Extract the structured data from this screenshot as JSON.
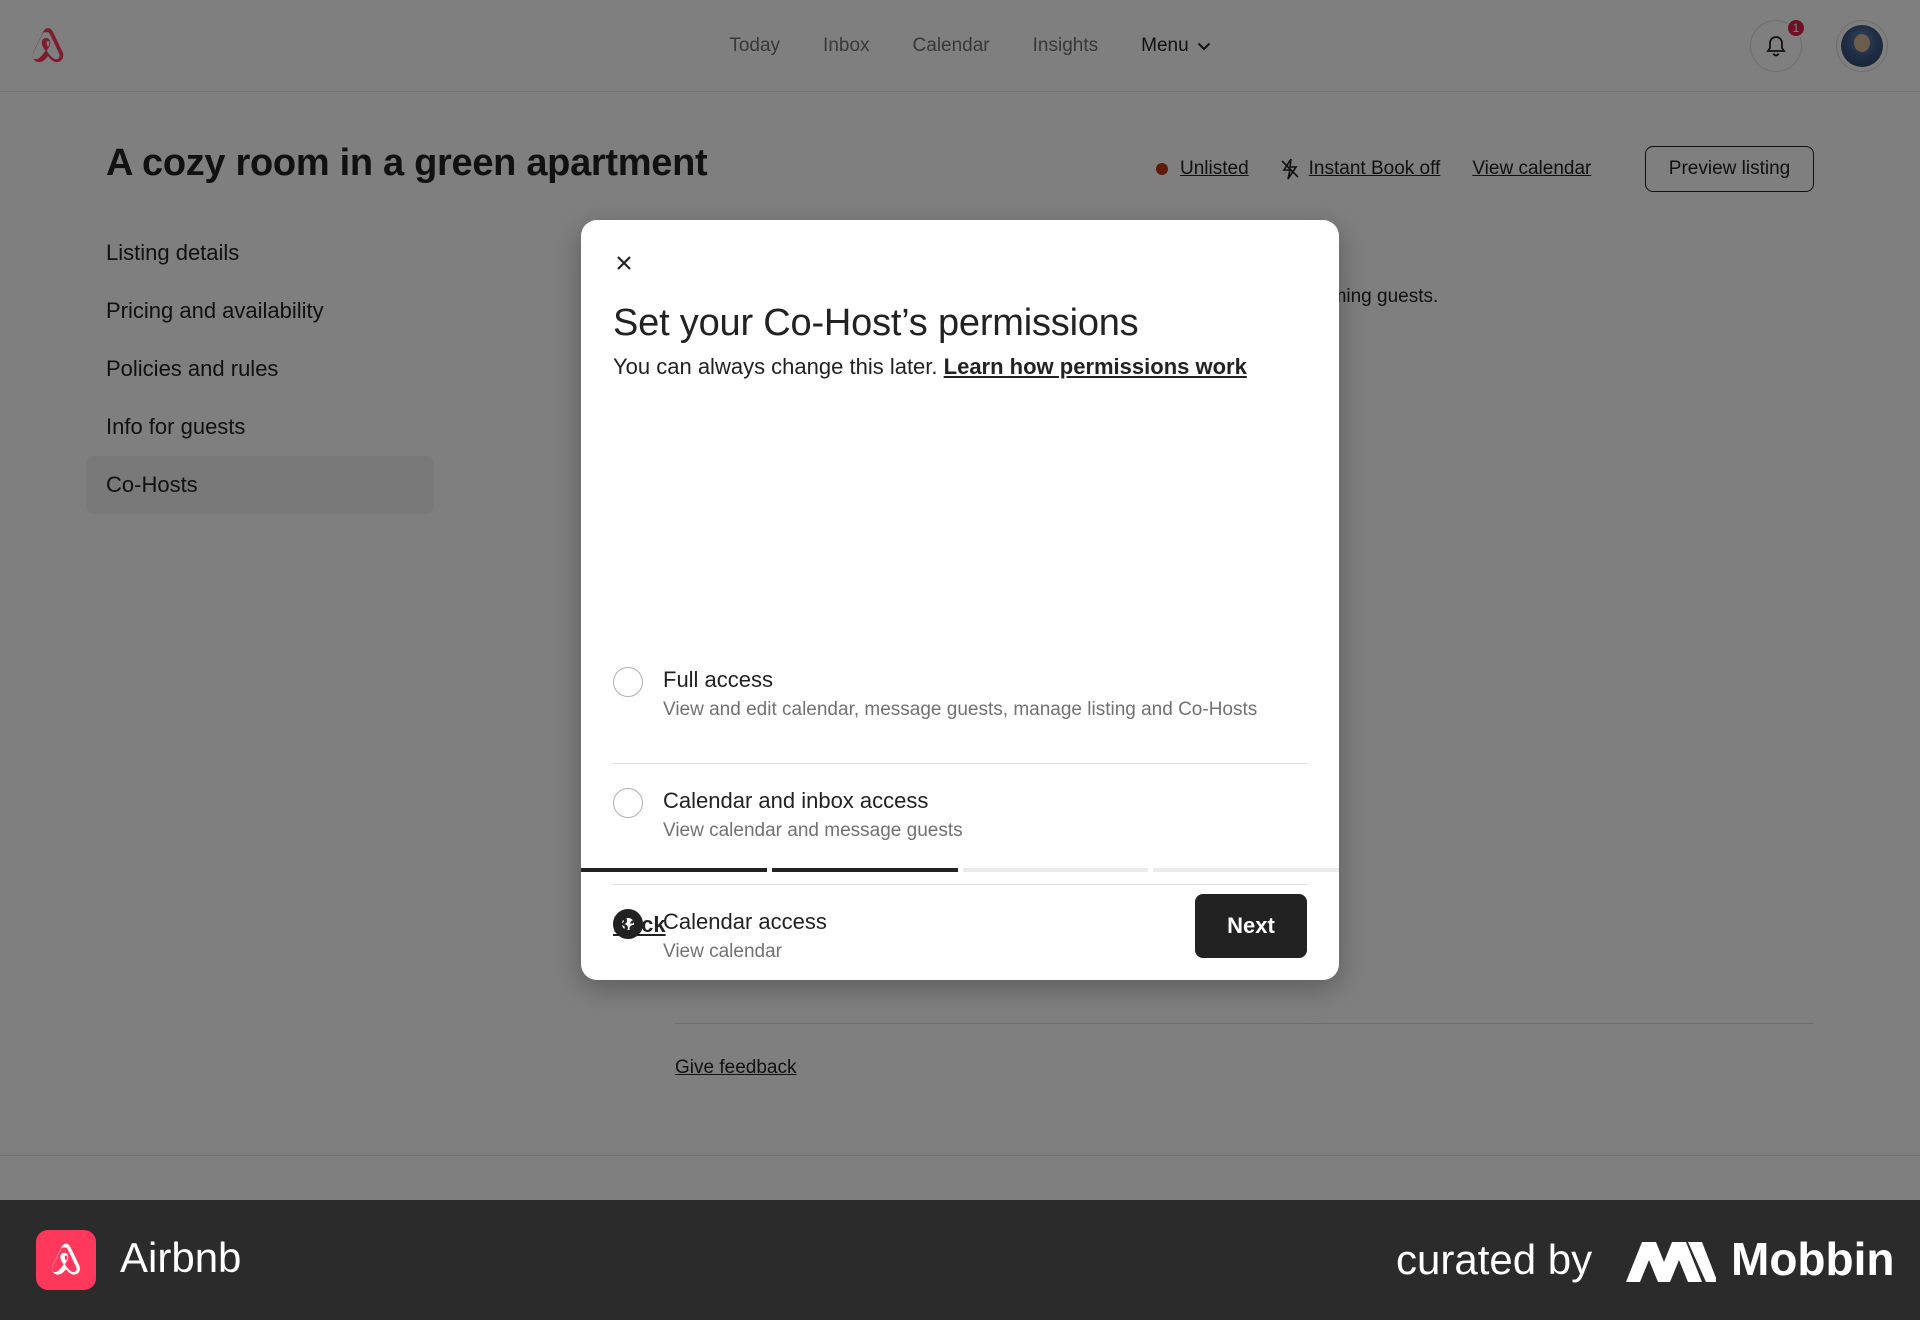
{
  "nav": {
    "links": [
      "Today",
      "Inbox",
      "Calendar",
      "Insights"
    ],
    "menu_label": "Menu",
    "notification_count": "1"
  },
  "listing": {
    "title": "A cozy room in a green apartment",
    "status": "Unlisted",
    "instant_book": "Instant Book off",
    "view_calendar": "View calendar",
    "preview": "Preview listing"
  },
  "sidebar": {
    "items": [
      {
        "label": "Listing details"
      },
      {
        "label": "Pricing and availability"
      },
      {
        "label": "Policies and rules"
      },
      {
        "label": "Info for guests"
      },
      {
        "label": "Co-Hosts"
      }
    ],
    "active_index": 4
  },
  "background": {
    "partial_text": "oming guests.",
    "feedback": "Give feedback"
  },
  "modal": {
    "title": "Set your Co-Host’s permissions",
    "subtitle": "You can always change this later.",
    "learn_link": "Learn how permissions work",
    "options": [
      {
        "title": "Full access",
        "description": "View and edit calendar, message guests, manage listing and Co-Hosts",
        "selected": false
      },
      {
        "title": "Calendar and inbox access",
        "description": "View calendar and message guests",
        "selected": false
      },
      {
        "title": "Calendar access",
        "description": "View calendar",
        "selected": true
      }
    ],
    "progress": {
      "step": 2,
      "total": 4
    },
    "back": "Back",
    "next": "Next"
  },
  "branding": {
    "app_name": "Airbnb",
    "curated_by": "curated by",
    "curator": "Mobbin"
  },
  "colors": {
    "airbnb_red": "#ff385c",
    "status_unlisted": "#c13515",
    "primary_dark": "#222222"
  }
}
